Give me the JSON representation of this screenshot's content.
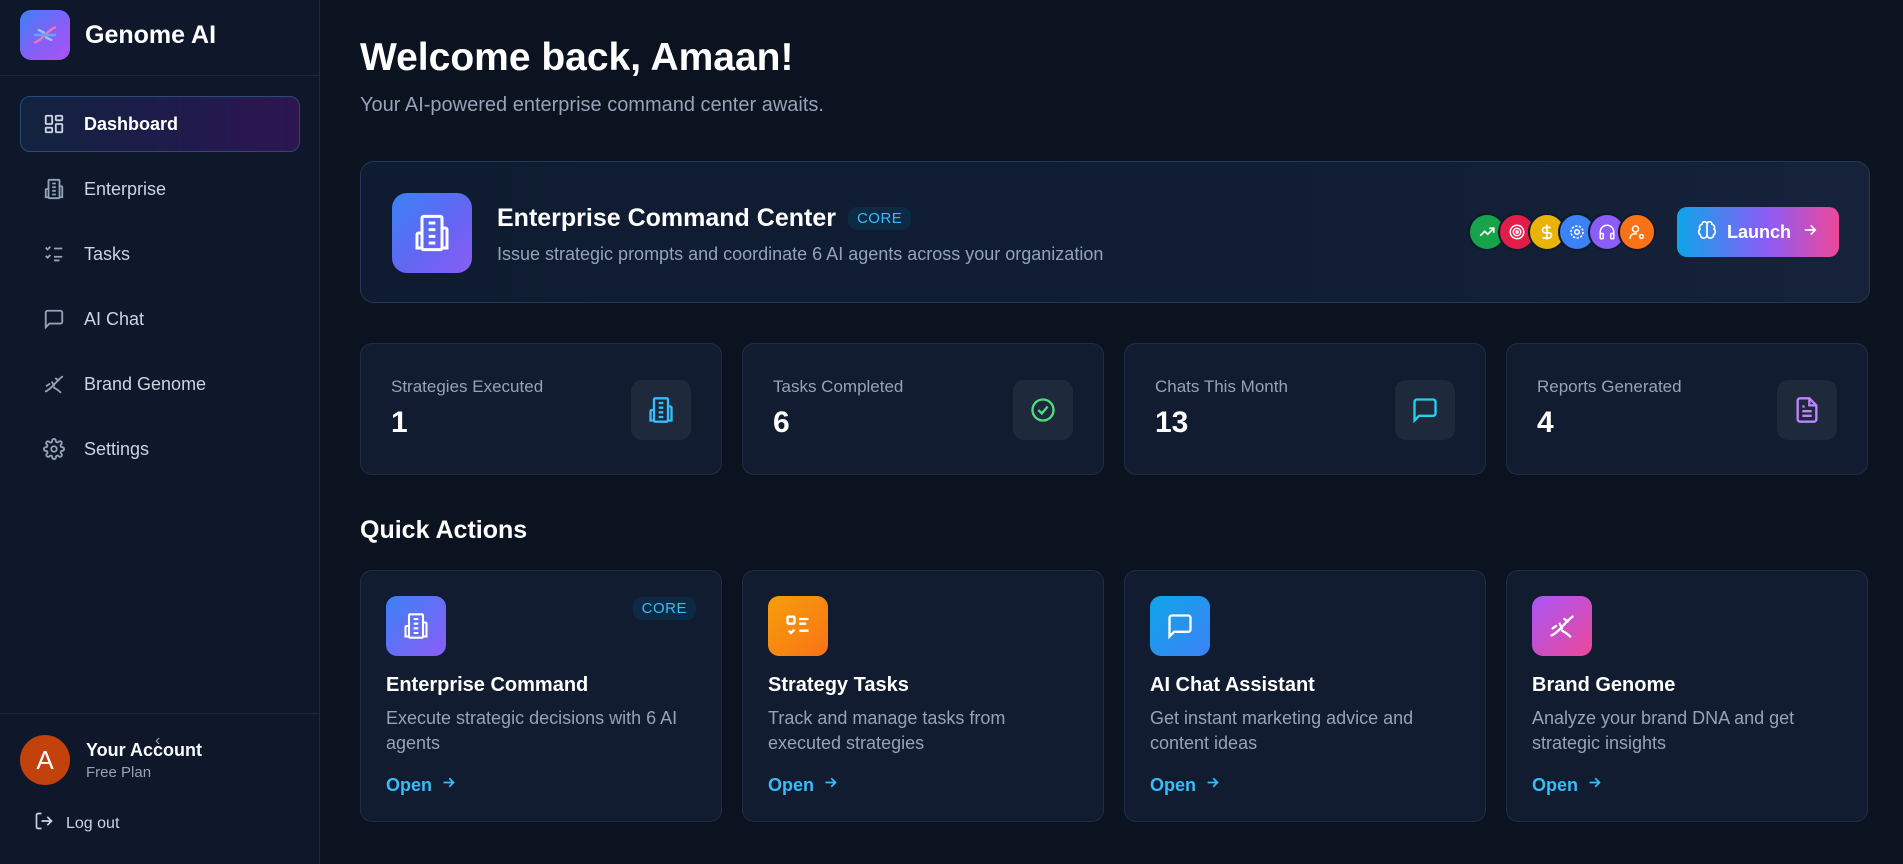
{
  "app": {
    "name": "Genome AI"
  },
  "sidebar": {
    "items": [
      {
        "label": "Dashboard",
        "icon": "layout-dashboard-icon",
        "active": true
      },
      {
        "label": "Enterprise",
        "icon": "building-icon"
      },
      {
        "label": "Tasks",
        "icon": "list-checks-icon"
      },
      {
        "label": "AI Chat",
        "icon": "message-square-icon"
      },
      {
        "label": "Brand Genome",
        "icon": "dna-icon"
      },
      {
        "label": "Settings",
        "icon": "gear-icon"
      }
    ],
    "account": {
      "initial": "A",
      "name": "Your Account",
      "plan": "Free Plan"
    },
    "logout_label": "Log out"
  },
  "header": {
    "welcome": "Welcome back, Amaan!",
    "subtitle": "Your AI-powered enterprise command center awaits."
  },
  "hero": {
    "title": "Enterprise Command Center",
    "badge": "CORE",
    "description": "Issue strategic prompts and coordinate 6 AI agents across your organization",
    "launch_label": "Launch",
    "agents": [
      {
        "icon": "trending-up-icon",
        "color": "#16a34a"
      },
      {
        "icon": "target-icon",
        "color": "#e11d48"
      },
      {
        "icon": "dollar-icon",
        "color": "#eab308"
      },
      {
        "icon": "gear-icon",
        "color": "#3b82f6"
      },
      {
        "icon": "headphones-icon",
        "color": "#8b5cf6"
      },
      {
        "icon": "user-cog-icon",
        "color": "#f97316"
      }
    ]
  },
  "stats": [
    {
      "label": "Strategies Executed",
      "value": "1",
      "icon": "building-icon",
      "color": "#38bdf8"
    },
    {
      "label": "Tasks Completed",
      "value": "6",
      "icon": "check-circle-icon",
      "color": "#4ade80"
    },
    {
      "label": "Chats This Month",
      "value": "13",
      "icon": "message-square-icon",
      "color": "#22d3ee"
    },
    {
      "label": "Reports Generated",
      "value": "4",
      "icon": "file-text-icon",
      "color": "#c084fc"
    }
  ],
  "quick_actions": {
    "title": "Quick Actions",
    "cards": [
      {
        "title": "Enterprise Command",
        "badge": "CORE",
        "description": "Execute strategic decisions with 6 AI agents",
        "open_label": "Open",
        "icon": "building-icon"
      },
      {
        "title": "Strategy Tasks",
        "description": "Track and manage tasks from executed strategies",
        "open_label": "Open",
        "icon": "list-checks-icon"
      },
      {
        "title": "AI Chat Assistant",
        "description": "Get instant marketing advice and content ideas",
        "open_label": "Open",
        "icon": "message-square-icon"
      },
      {
        "title": "Brand Genome",
        "description": "Analyze your brand DNA and get strategic insights",
        "open_label": "Open",
        "icon": "dna-icon"
      }
    ]
  }
}
